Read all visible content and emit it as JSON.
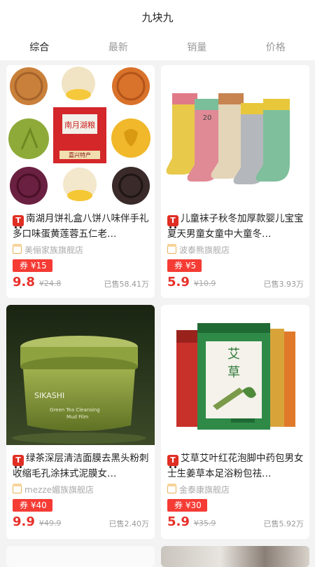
{
  "header": {
    "title": "九块九"
  },
  "tabs": [
    {
      "label": "综合",
      "active": true
    },
    {
      "label": "最新",
      "active": false
    },
    {
      "label": "销量",
      "active": false
    },
    {
      "label": "价格",
      "active": false
    }
  ],
  "products": [
    {
      "title": "南湖月饼礼盒八饼八味伴手礼多口味蛋黄莲蓉五仁老…",
      "shop": "美俪家族旗舰店",
      "coupon": "券 ¥15",
      "price": "9.8",
      "original_price": "¥24.8",
      "sold": "已售58.41万",
      "image_text": "南月湖粮",
      "image_subtext": "嘉兴特产"
    },
    {
      "title": "儿童袜子秋冬加厚款婴儿宝宝夏天男童女童中大童冬…",
      "shop": "波泰熊旗舰店",
      "coupon": "券 ¥5",
      "price": "5.9",
      "original_price": "¥10.9",
      "sold": "已售3.93万",
      "sock_label": "20"
    },
    {
      "title": "绿茶深层清洁面膜去黑头粉刺收缩毛孔涂抹式泥膜女…",
      "shop": "mezze媚族旗舰店",
      "coupon": "券 ¥40",
      "price": "9.9",
      "original_price": "¥49.9",
      "sold": "已售2.40万",
      "brand": "SIKASHI",
      "product_line": "Green Tea Cleansing",
      "product_sub": "Mud Film"
    },
    {
      "title": "艾草艾叶红花泡脚中药包男女士生姜草本足浴粉包祛…",
      "shop": "金泰康旗舰店",
      "coupon": "券 ¥30",
      "price": "5.9",
      "original_price": "¥35.9",
      "sold": "已售5.92万",
      "pack_text_1": "艾",
      "pack_text_2": "草"
    }
  ],
  "colors": {
    "accent": "#e8302a",
    "coupon_bg": "#f53b34",
    "tmall_badge": "#e02e24"
  }
}
